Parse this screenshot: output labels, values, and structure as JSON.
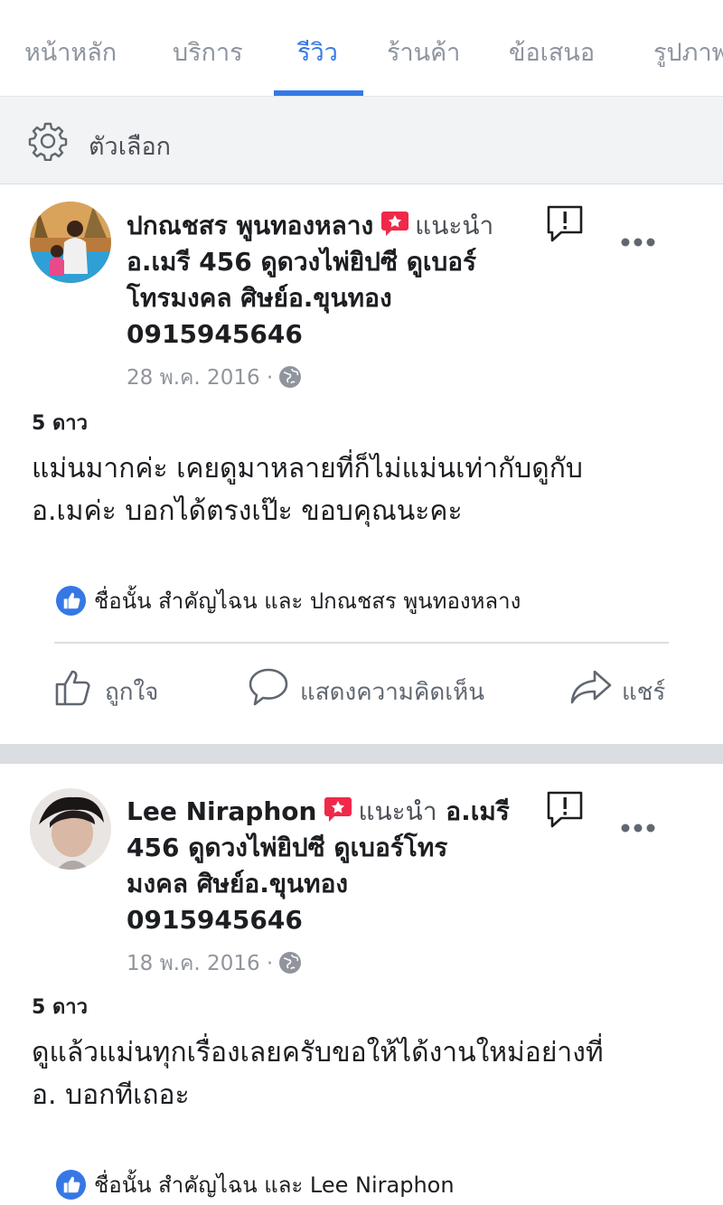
{
  "tabs": [
    {
      "label": "หน้าหลัก",
      "active": false
    },
    {
      "label": "บริการ",
      "active": false
    },
    {
      "label": "รีวิว",
      "active": true
    },
    {
      "label": "ร้านค้า",
      "active": false
    },
    {
      "label": "ข้อเสนอ",
      "active": false
    },
    {
      "label": "รูปภาพ",
      "active": false
    }
  ],
  "options_label": "ตัวเลือก",
  "colors": {
    "accent": "#3578e5",
    "recommend_badge": "#f02849",
    "muted_text": "#90949c",
    "divider": "#dadde1"
  },
  "reviews": [
    {
      "author": "ปกณชสร พูนทองหลาง",
      "recommend_label": "แนะนำ",
      "page_line_1": "อ.เมรี 456 ดูดวงไพ่ยิปซี ดูเบอร์",
      "page_line_2": "โทรมงคล ศิษย์อ.ขุนทอง",
      "page_line_3": "0915945646",
      "date": "28 พ.ค. 2016 ·",
      "rating": "5 ดาว",
      "text_line_1": "แม่นมากค่ะ เคยดูมาหลายที่ก็ไม่แม่นเท่ากับดูกับ",
      "text_line_2": "อ.เมค่ะ บอกได้ตรงเป๊ะ ขอบคุณนะคะ",
      "likes": "ชื่อนั้น สำคัญไฉน และ ปกณชสร พูนทองหลาง"
    },
    {
      "author": "Lee Niraphon",
      "recommend_label": "แนะนำ",
      "page_inline": "อ.เมรี",
      "page_line_1": "456 ดูดวงไพ่ยิปซี ดูเบอร์โทร",
      "page_line_2": "มงคล ศิษย์อ.ขุนทอง",
      "page_line_3": "0915945646",
      "date": "18 พ.ค. 2016 ·",
      "rating": "5 ดาว",
      "text_line_1": "ดูแล้วแม่นทุกเรื่องเลยครับขอให้ได้งานใหม่อย่างที่",
      "text_line_2": "อ. บอกทีเถอะ",
      "likes": "ชื่อนั้น สำคัญไฉน และ Lee Niraphon"
    }
  ],
  "actions": {
    "like": "ถูกใจ",
    "comment": "แสดงความคิดเห็น",
    "share": "แชร์"
  },
  "icons": [
    "gear-icon",
    "recommend-star-icon",
    "report-flag-icon",
    "more-icon",
    "globe-icon",
    "like-badge-icon",
    "thumbs-up-icon",
    "comment-icon",
    "share-icon"
  ]
}
